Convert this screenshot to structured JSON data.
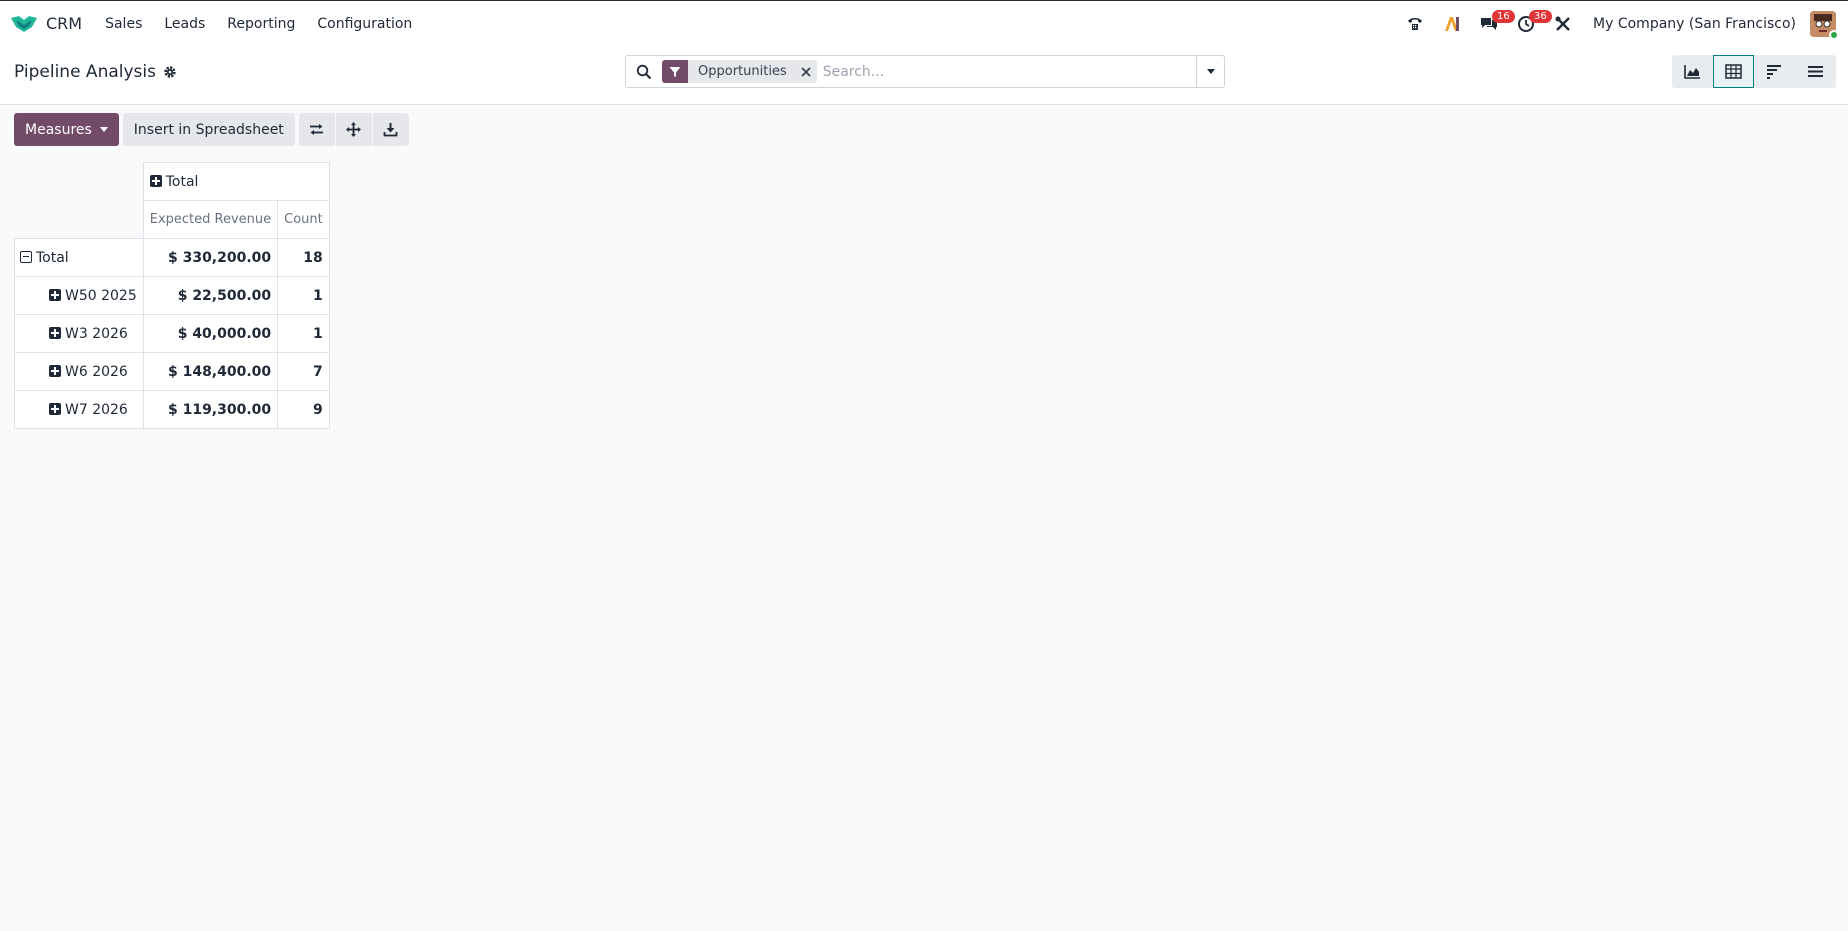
{
  "app": {
    "name": "CRM",
    "menu": [
      "Sales",
      "Leads",
      "Reporting",
      "Configuration"
    ]
  },
  "systray": {
    "messages_count": "16",
    "activities_count": "36",
    "company": "My Company (San Francisco)"
  },
  "control_panel": {
    "title": "Pipeline Analysis",
    "facet_label": "Opportunities",
    "search_placeholder": "Search..."
  },
  "toolbar": {
    "measures_label": "Measures",
    "insert_label": "Insert in Spreadsheet"
  },
  "pivot": {
    "col_header": "Total",
    "measures": [
      "Expected Revenue",
      "Count"
    ],
    "total_label": "Total",
    "total_revenue": "$ 330,200.00",
    "total_count": "18",
    "rows": [
      {
        "label": "W50 2025",
        "revenue": "$ 22,500.00",
        "count": "1"
      },
      {
        "label": "W3 2026",
        "revenue": "$ 40,000.00",
        "count": "1"
      },
      {
        "label": "W6 2026",
        "revenue": "$ 148,400.00",
        "count": "7"
      },
      {
        "label": "W7 2026",
        "revenue": "$ 119,300.00",
        "count": "9"
      }
    ]
  },
  "colors": {
    "brand": "#714b67",
    "accent": "#017e84",
    "badge": "#e0363a"
  }
}
